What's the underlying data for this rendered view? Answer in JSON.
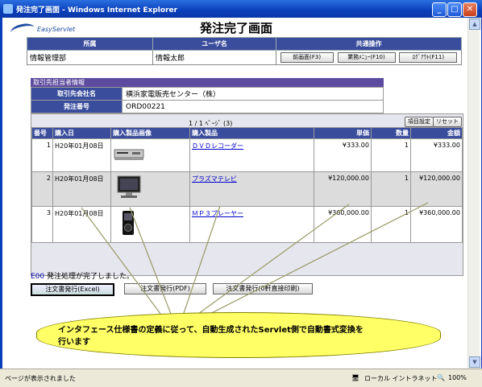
{
  "window": {
    "title": "発注完了画面 - Windows Internet Explorer"
  },
  "app": {
    "logo": "EasyServlet",
    "page_title": "発注完了画面"
  },
  "user_table": {
    "headers": [
      "所属",
      "ユーザ名",
      "共通操作"
    ],
    "dept": "情報管理部",
    "user": "情報太郎",
    "buttons": [
      "前画面(F3)",
      "業務ﾒﾆｭｰ(F10)",
      "ﾛｸﾞｱｳﾄ(F11)"
    ]
  },
  "supplier": {
    "section_title": "取引先担当者情報",
    "company_label": "取引先会社名",
    "company_value": "横浜家電販売センター（株）",
    "order_label": "発注番号",
    "order_value": "ORD00221"
  },
  "list": {
    "pager": "1 / 1 ﾍﾟｰｼﾞ (3)",
    "toolbar": [
      "項目設定",
      "リセット"
    ],
    "columns": [
      "番号",
      "購入日",
      "購入製品画像",
      "購入製品",
      "単価",
      "数量",
      "金額"
    ],
    "rows": [
      {
        "no": "1",
        "date": "H20年01月08日",
        "image": "dvd-recorder-image",
        "product": "ＤＶＤレコーダー",
        "price": "¥333.00",
        "qty": "1",
        "amount": "¥333.00"
      },
      {
        "no": "2",
        "date": "H20年01月08日",
        "image": "plasma-tv-image",
        "product": "プラズマテレビ",
        "price": "¥120,000.00",
        "qty": "1",
        "amount": "¥120,000.00"
      },
      {
        "no": "3",
        "date": "H20年01月08日",
        "image": "mp3-player-image",
        "product": "ＭＰ３プレーヤー",
        "price": "¥360,000.00",
        "qty": "1",
        "amount": "¥360,000.00"
      }
    ]
  },
  "message": {
    "code": "E00",
    "text": "発注処理が完了しました。"
  },
  "actions": [
    "注文書発行(Excel)",
    "注文書発行(PDF)",
    "注文書発行(0軒直接印刷)"
  ],
  "callout": {
    "text": "インタフェース仕様書の定義に従って、自動生成されたServlet側で自動書式変換を\n行います"
  },
  "statusbar": {
    "left": "ページが表示されました",
    "zone": "ローカル イントラネット",
    "zoom": "100%"
  }
}
